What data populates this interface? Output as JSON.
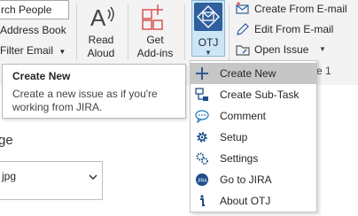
{
  "ribbon": {
    "search_people": "rch People",
    "address_book": "Address Book",
    "filter_email": "Filter Email",
    "read_aloud": [
      "Read",
      "Aloud"
    ],
    "get_addins": [
      "Get",
      "Add-ins"
    ],
    "otj_label": "OTJ",
    "create_from_email": "Create From E-mail",
    "edit_from_email": "Edit From E-mail",
    "open_issue": "Open Issue",
    "group_caption": "e 1"
  },
  "tooltip": {
    "title": "Create New",
    "body": "Create a new issue as if you're working from JIRA."
  },
  "menu": {
    "items": [
      {
        "label": "Create New",
        "icon": "plus-icon",
        "highlighted": true
      },
      {
        "label": "Create Sub-Task",
        "icon": "subtask-icon"
      },
      {
        "label": "Comment",
        "icon": "comment-icon"
      },
      {
        "label": "Setup",
        "icon": "gear-icon"
      },
      {
        "label": "Settings",
        "icon": "settings-icon"
      },
      {
        "label": "Go to JIRA",
        "icon": "jira-icon"
      },
      {
        "label": "About OTJ",
        "icon": "info-icon"
      }
    ]
  },
  "main": {
    "heading": "ge",
    "dropdown_value": "jpg"
  }
}
